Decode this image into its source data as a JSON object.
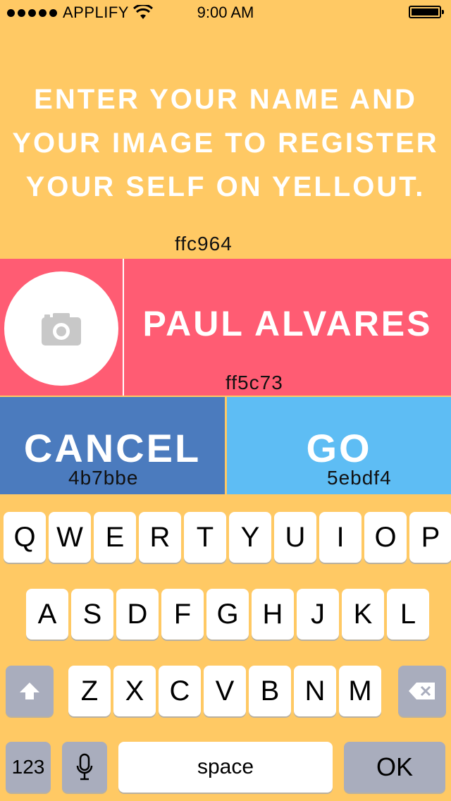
{
  "status_bar": {
    "carrier": "APPLIFY",
    "time": "9:00 AM"
  },
  "heading": {
    "lines": [
      "ENTER YOUR NAME AND",
      "YOUR IMAGE TO REGISTER",
      "YOUR SELF ON YELLOUT."
    ]
  },
  "labels": {
    "top_color": "ffc964",
    "band_color": "ff5c73",
    "cancel_color": "4b7bbe",
    "go_color": "5ebdf4"
  },
  "profile": {
    "name": "PAUL ALVARES"
  },
  "actions": {
    "cancel": "CANCEL",
    "go": "GO"
  },
  "keyboard": {
    "row1": [
      "Q",
      "W",
      "E",
      "R",
      "T",
      "Y",
      "U",
      "I",
      "O",
      "P"
    ],
    "row2": [
      "A",
      "S",
      "D",
      "F",
      "G",
      "H",
      "J",
      "K",
      "L"
    ],
    "row3": [
      "Z",
      "X",
      "C",
      "V",
      "B",
      "N",
      "M"
    ],
    "numbers": "123",
    "space": "space",
    "ok": "OK"
  },
  "colors": {
    "background": "#ffc964",
    "band": "#ff5c73",
    "cancel": "#4b7bbe",
    "go": "#5ebdf4",
    "special_key": "#a9adbd"
  }
}
